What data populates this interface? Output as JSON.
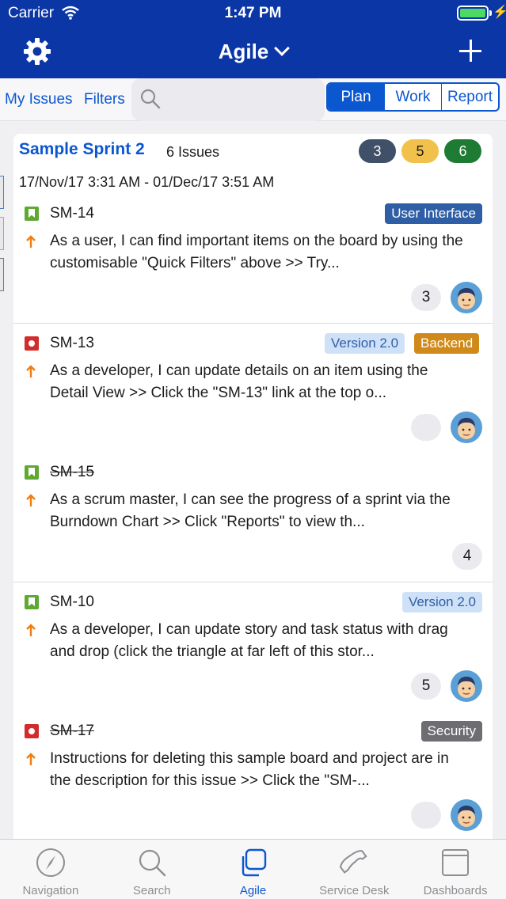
{
  "status_bar": {
    "carrier": "Carrier",
    "time": "1:47 PM"
  },
  "header": {
    "title": "Agile"
  },
  "toolbar": {
    "my_issues": "My Issues",
    "filters": "Filters",
    "segments": [
      "Plan",
      "Work",
      "Report"
    ],
    "selected_segment": "Plan"
  },
  "sprint": {
    "name": "Sample Sprint 2",
    "issue_count": "6 Issues",
    "status_counts": [
      {
        "value": "3",
        "color": "#3f5068",
        "text_color": "#ffffff"
      },
      {
        "value": "5",
        "color": "#f2c14b",
        "text_color": "#1c1c1e"
      },
      {
        "value": "6",
        "color": "#1e7b34",
        "text_color": "#ffffff"
      }
    ],
    "dates": "17/Nov/17 3:31 AM - 01/Dec/17 3:51 AM"
  },
  "issues": [
    {
      "key": "SM-14",
      "type": "story",
      "done": false,
      "summary": "As a user, I can find important items on the board by using the customisable \"Quick Filters\" above >> Try...",
      "labels": [
        "User Interface"
      ],
      "count": "3"
    },
    {
      "key": "SM-13",
      "type": "bug",
      "done": false,
      "summary": "As a developer, I can update details on an item using the Detail View >> Click the \"SM-13\" link at the top o...",
      "labels": [
        "Version 2.0",
        "Backend"
      ],
      "count": ""
    },
    {
      "key": "SM-15",
      "type": "story",
      "done": true,
      "summary": "As a scrum master, I can see the progress of a sprint via the Burndown Chart >> Click \"Reports\" to view th...",
      "labels": [],
      "count": "4"
    },
    {
      "key": "SM-10",
      "type": "story",
      "done": false,
      "summary": "As a developer, I can update story and task status with drag and drop (click the triangle at far left of this stor...",
      "labels": [
        "Version 2.0"
      ],
      "count": "5"
    },
    {
      "key": "SM-17",
      "type": "bug",
      "done": true,
      "summary": "Instructions for deleting this sample board and project are in the description for this issue >> Click the \"SM-...",
      "labels": [
        "Security"
      ],
      "count": ""
    }
  ],
  "tabs": [
    {
      "label": "Navigation",
      "icon": "compass-icon"
    },
    {
      "label": "Search",
      "icon": "magnifier-icon"
    },
    {
      "label": "Agile",
      "icon": "agile-icon",
      "active": true
    },
    {
      "label": "Service Desk",
      "icon": "phone-icon"
    },
    {
      "label": "Dashboards",
      "icon": "dashboard-icon"
    }
  ],
  "colors": {
    "brand": "#0b36a6",
    "accent": "#0b57d0",
    "story": "#5fa832",
    "bug": "#d22c2c",
    "priority": "#f07c14"
  }
}
